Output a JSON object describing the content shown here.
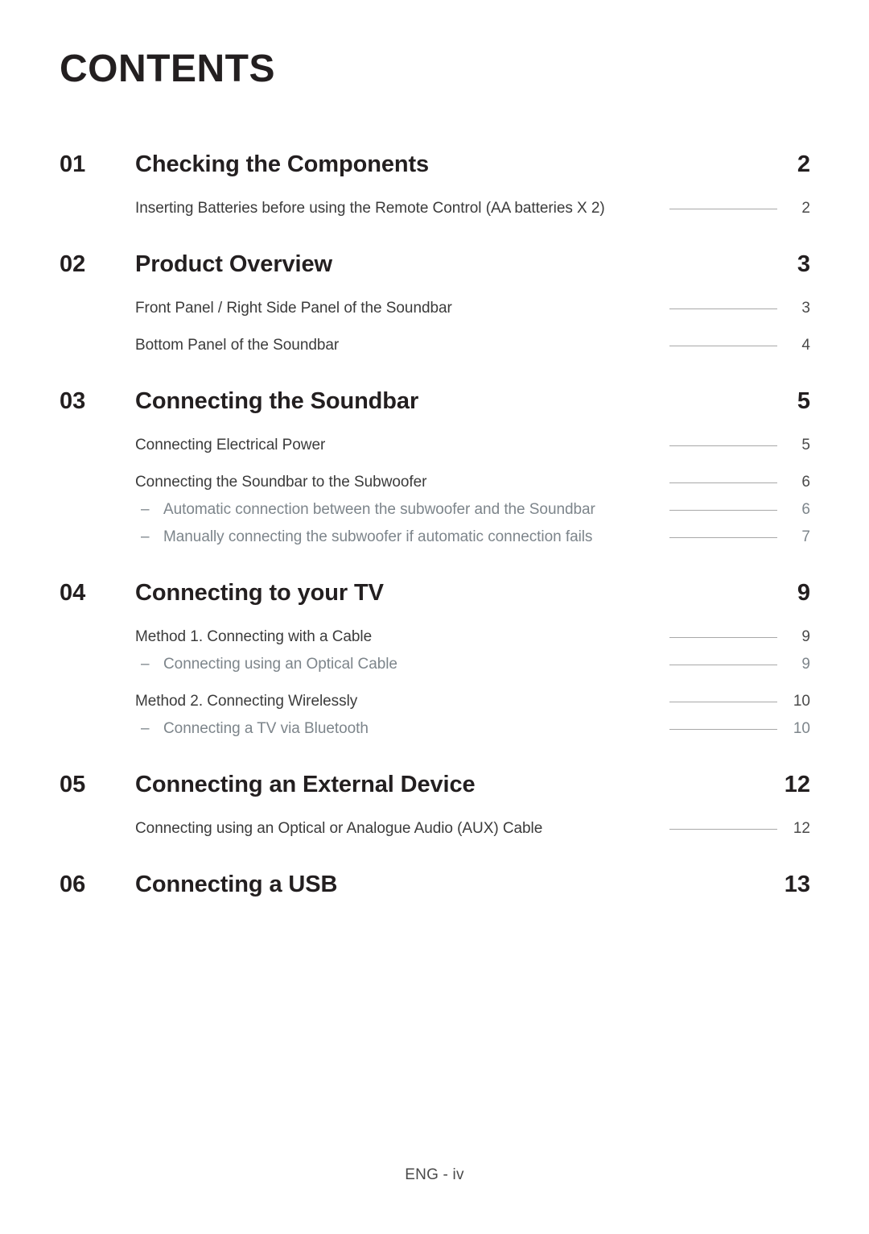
{
  "document": {
    "title": "CONTENTS",
    "footer": "ENG - iv"
  },
  "toc": {
    "chapters": [
      {
        "number": "01",
        "title": "Checking the Components",
        "page": "2",
        "entries": [
          {
            "label": "Inserting Batteries before using the Remote Control (AA batteries X 2)",
            "page": "2",
            "level": 1,
            "group_top": true
          }
        ]
      },
      {
        "number": "02",
        "title": "Product Overview",
        "page": "3",
        "entries": [
          {
            "label": "Front Panel / Right Side Panel of the Soundbar",
            "page": "3",
            "level": 1,
            "group_top": true
          },
          {
            "label": "Bottom Panel of the Soundbar",
            "page": "4",
            "level": 1,
            "group_top": true
          }
        ]
      },
      {
        "number": "03",
        "title": "Connecting the Soundbar",
        "page": "5",
        "entries": [
          {
            "label": "Connecting Electrical Power",
            "page": "5",
            "level": 1,
            "group_top": true
          },
          {
            "label": "Connecting the Soundbar to the Subwoofer",
            "page": "6",
            "level": 1,
            "group_top": true
          },
          {
            "dash": "–",
            "label": "Automatic connection between the subwoofer and the Soundbar",
            "page": "6",
            "level": 2,
            "group_top": false
          },
          {
            "dash": "–",
            "label": "Manually connecting the subwoofer if automatic connection fails",
            "page": "7",
            "level": 2,
            "group_top": false
          }
        ]
      },
      {
        "number": "04",
        "title": "Connecting to your TV",
        "page": "9",
        "entries": [
          {
            "label": "Method 1. Connecting with a Cable",
            "page": "9",
            "level": 1,
            "group_top": true
          },
          {
            "dash": "–",
            "label": "Connecting using an Optical Cable",
            "page": "9",
            "level": 2,
            "group_top": false
          },
          {
            "label": "Method 2. Connecting Wirelessly",
            "page": "10",
            "level": 1,
            "group_top": true
          },
          {
            "dash": "–",
            "label": "Connecting a TV via Bluetooth",
            "page": "10",
            "level": 2,
            "group_top": false
          }
        ]
      },
      {
        "number": "05",
        "title": "Connecting an External Device",
        "page": "12",
        "entries": [
          {
            "label": "Connecting using an Optical or Analogue Audio (AUX) Cable",
            "page": "12",
            "level": 1,
            "group_top": true
          }
        ]
      },
      {
        "number": "06",
        "title": "Connecting a USB",
        "page": "13",
        "entries": []
      }
    ]
  }
}
